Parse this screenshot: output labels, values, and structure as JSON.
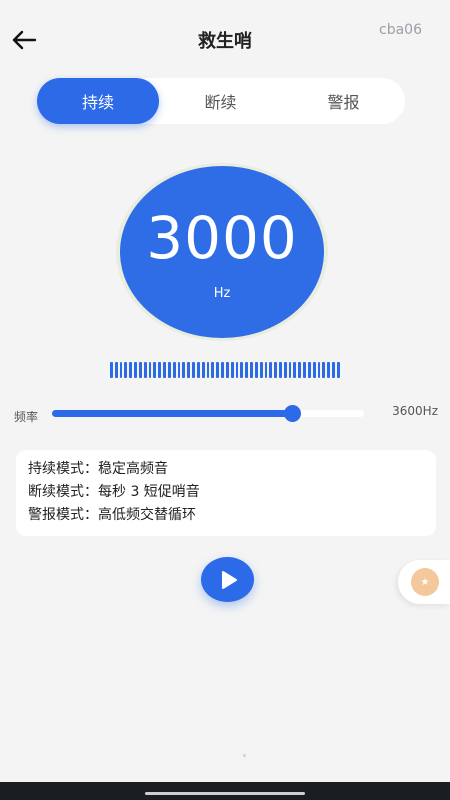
{
  "header": {
    "title": "救生哨",
    "corner_code": "cba06",
    "back_icon": "arrow-left-icon"
  },
  "tabs": [
    {
      "label": "持续",
      "active": true
    },
    {
      "label": "断续",
      "active": false
    },
    {
      "label": "警报",
      "active": false
    }
  ],
  "frequency": {
    "value": "3000",
    "unit": "Hz"
  },
  "slider": {
    "label": "频率",
    "max_label": "3600Hz",
    "level_fraction": 0.77
  },
  "info": {
    "lines": [
      "持续模式：稳定高频音",
      "断续模式：每秒 3 短促哨音",
      "警报模式：高低频交替循环"
    ]
  },
  "controls": {
    "play_icon": "play-icon",
    "float_icon": "star-badge-icon"
  },
  "colors": {
    "accent": "#2c6ae8",
    "background": "#f4f4f4",
    "float_badge": "#f3c89a"
  }
}
